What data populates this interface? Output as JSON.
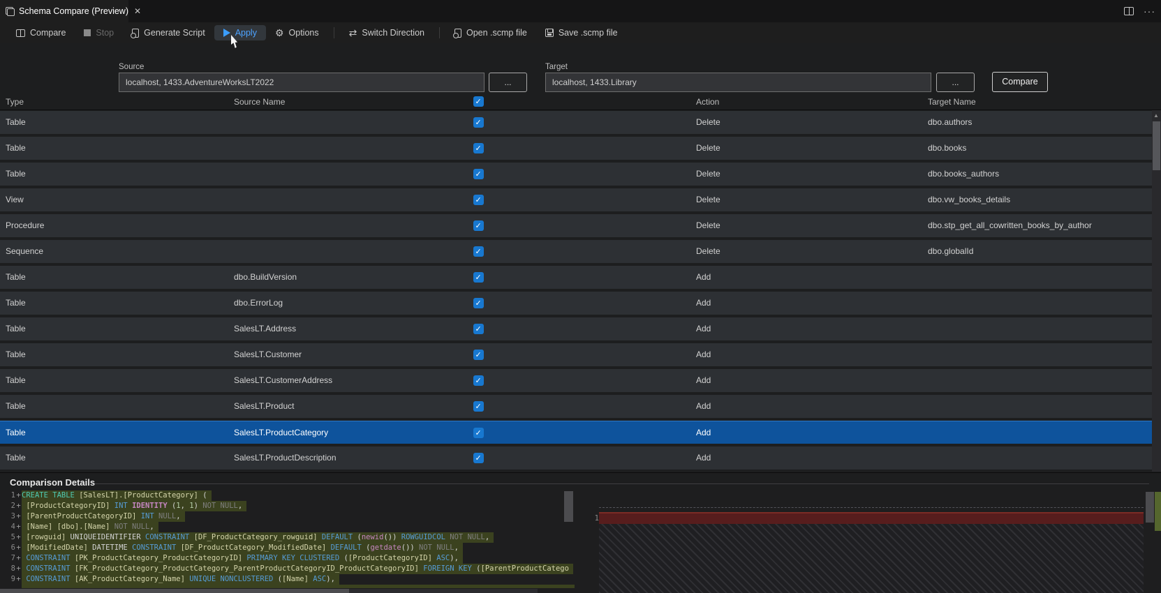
{
  "tab": {
    "title": "Schema Compare (Preview)"
  },
  "window_icons": [
    "split-editor-icon",
    "more-actions-icon"
  ],
  "toolbar": {
    "items": [
      {
        "label": "Compare",
        "icon": "compare-columns-icon"
      },
      {
        "label": "Stop",
        "icon": "stop-square-icon",
        "disabled": true
      },
      {
        "label": "Generate Script",
        "icon": "script-file-icon"
      },
      {
        "label": "Apply",
        "icon": "play-icon",
        "active": true
      },
      {
        "label": "Options",
        "icon": "gear-icon"
      },
      {
        "label": "Switch Direction",
        "icon": "swap-arrows-icon"
      },
      {
        "label": "Open .scmp file",
        "icon": "file-open-icon"
      },
      {
        "label": "Save .scmp file",
        "icon": "save-icon"
      }
    ]
  },
  "connections": {
    "source_label": "Source",
    "source_value": "localhost, 1433.AdventureWorksLT2022",
    "target_label": "Target",
    "target_value": "localhost, 1433.Library",
    "browse_label": "...",
    "compare_button": "Compare"
  },
  "grid": {
    "columns": [
      "Type",
      "Source Name",
      "Action",
      "Target Name"
    ],
    "rows": [
      {
        "type": "Table",
        "source": "",
        "checked": true,
        "action": "Delete",
        "target": "dbo.authors"
      },
      {
        "type": "Table",
        "source": "",
        "checked": true,
        "action": "Delete",
        "target": "dbo.books"
      },
      {
        "type": "Table",
        "source": "",
        "checked": true,
        "action": "Delete",
        "target": "dbo.books_authors"
      },
      {
        "type": "View",
        "source": "",
        "checked": true,
        "action": "Delete",
        "target": "dbo.vw_books_details"
      },
      {
        "type": "Procedure",
        "source": "",
        "checked": true,
        "action": "Delete",
        "target": "dbo.stp_get_all_cowritten_books_by_author"
      },
      {
        "type": "Sequence",
        "source": "",
        "checked": true,
        "action": "Delete",
        "target": "dbo.globalId"
      },
      {
        "type": "Table",
        "source": "dbo.BuildVersion",
        "checked": true,
        "action": "Add",
        "target": ""
      },
      {
        "type": "Table",
        "source": "dbo.ErrorLog",
        "checked": true,
        "action": "Add",
        "target": ""
      },
      {
        "type": "Table",
        "source": "SalesLT.Address",
        "checked": true,
        "action": "Add",
        "target": ""
      },
      {
        "type": "Table",
        "source": "SalesLT.Customer",
        "checked": true,
        "action": "Add",
        "target": ""
      },
      {
        "type": "Table",
        "source": "SalesLT.CustomerAddress",
        "checked": true,
        "action": "Add",
        "target": ""
      },
      {
        "type": "Table",
        "source": "SalesLT.Product",
        "checked": true,
        "action": "Add",
        "target": ""
      },
      {
        "type": "Table",
        "source": "SalesLT.ProductCategory",
        "checked": true,
        "action": "Add",
        "target": "",
        "selected": true
      },
      {
        "type": "Table",
        "source": "SalesLT.ProductDescription",
        "checked": true,
        "action": "Add",
        "target": ""
      }
    ]
  },
  "details": {
    "title": "Comparison Details",
    "left_lines": [
      {
        "num": "1",
        "sign": "+",
        "segments": [
          [
            "t",
            "CREATE TABLE"
          ],
          [
            "w",
            " "
          ],
          [
            "i",
            "[SalesLT].[ProductCategory]"
          ],
          [
            "w",
            " ("
          ]
        ]
      },
      {
        "num": "2",
        "sign": "+",
        "segments": [
          [
            "w",
            " "
          ],
          [
            "i",
            "[ProductCategoryID]"
          ],
          [
            "w",
            " "
          ],
          [
            "k",
            "INT"
          ],
          [
            "w",
            " "
          ],
          [
            "mb",
            "IDENTITY"
          ],
          [
            "w",
            " ("
          ],
          [
            "n",
            "1"
          ],
          [
            "w",
            ", "
          ],
          [
            "n",
            "1"
          ],
          [
            "w",
            ")"
          ],
          [
            "g",
            " NOT NULL"
          ],
          [
            "w",
            ","
          ]
        ]
      },
      {
        "num": "3",
        "sign": "+",
        "segments": [
          [
            "w",
            " "
          ],
          [
            "i",
            "[ParentProductCategoryID]"
          ],
          [
            "w",
            " "
          ],
          [
            "k",
            "INT"
          ],
          [
            "g",
            " NULL"
          ],
          [
            "w",
            ","
          ]
        ]
      },
      {
        "num": "4",
        "sign": "+",
        "segments": [
          [
            "w",
            " "
          ],
          [
            "i",
            "[Name] [dbo].[Name]"
          ],
          [
            "g",
            " NOT NULL"
          ],
          [
            "w",
            ","
          ]
        ]
      },
      {
        "num": "5",
        "sign": "+",
        "segments": [
          [
            "w",
            " "
          ],
          [
            "i",
            "[rowguid]"
          ],
          [
            "w",
            " UNIQUEIDENTIFIER "
          ],
          [
            "k",
            "CONSTRAINT"
          ],
          [
            "w",
            " "
          ],
          [
            "i",
            "[DF_ProductCategory_rowguid]"
          ],
          [
            "w",
            " "
          ],
          [
            "k",
            "DEFAULT"
          ],
          [
            "w",
            " ("
          ],
          [
            "m",
            "newid"
          ],
          [
            "w",
            "())"
          ],
          [
            "k",
            " ROWGUIDCOL"
          ],
          [
            "g",
            " NOT NULL"
          ],
          [
            "w",
            ","
          ]
        ]
      },
      {
        "num": "6",
        "sign": "+",
        "segments": [
          [
            "w",
            " "
          ],
          [
            "i",
            "[ModifiedDate]"
          ],
          [
            "w",
            " DATETIME "
          ],
          [
            "k",
            "CONSTRAINT"
          ],
          [
            "w",
            " "
          ],
          [
            "i",
            "[DF_ProductCategory_ModifiedDate]"
          ],
          [
            "w",
            " "
          ],
          [
            "k",
            "DEFAULT"
          ],
          [
            "w",
            " ("
          ],
          [
            "m",
            "getdate"
          ],
          [
            "w",
            "())"
          ],
          [
            "g",
            " NOT NULL"
          ],
          [
            "w",
            ","
          ]
        ]
      },
      {
        "num": "7",
        "sign": "+",
        "segments": [
          [
            "w",
            " "
          ],
          [
            "k",
            "CONSTRAINT"
          ],
          [
            "w",
            " "
          ],
          [
            "i",
            "[PK_ProductCategory_ProductCategoryID]"
          ],
          [
            "w",
            " "
          ],
          [
            "k",
            "PRIMARY KEY CLUSTERED"
          ],
          [
            "w",
            " ("
          ],
          [
            "i",
            "[ProductCategoryID]"
          ],
          [
            "w",
            " "
          ],
          [
            "k",
            "ASC"
          ],
          [
            "w",
            "),"
          ]
        ]
      },
      {
        "num": "8",
        "sign": "+",
        "segments": [
          [
            "w",
            " "
          ],
          [
            "k",
            "CONSTRAINT"
          ],
          [
            "w",
            " "
          ],
          [
            "i",
            "[FK_ProductCategory_ProductCategory_ParentProductCategoryID_ProductCategoryID]"
          ],
          [
            "w",
            " "
          ],
          [
            "k",
            "FOREIGN KEY"
          ],
          [
            "w",
            " ("
          ],
          [
            "i",
            "[ParentProductCatego"
          ]
        ]
      },
      {
        "num": "9",
        "sign": "+",
        "segments": [
          [
            "w",
            " "
          ],
          [
            "k",
            "CONSTRAINT"
          ],
          [
            "w",
            " "
          ],
          [
            "i",
            "[AK_ProductCategory_Name]"
          ],
          [
            "w",
            " "
          ],
          [
            "k",
            "UNIQUE NONCLUSTERED"
          ],
          [
            "w",
            " ("
          ],
          [
            "i",
            "[Name]"
          ],
          [
            "w",
            " "
          ],
          [
            "k",
            "ASC"
          ],
          [
            "w",
            "),"
          ]
        ]
      }
    ],
    "right_line_number": "1",
    "right_sign": "−"
  },
  "colors": {
    "selection_blue": "#0e539c",
    "checkbox_blue": "#1878d0",
    "apply_blue": "#4da3ff",
    "added_line_bg": "#3b421f",
    "removed_line_bg": "#571d1d"
  }
}
